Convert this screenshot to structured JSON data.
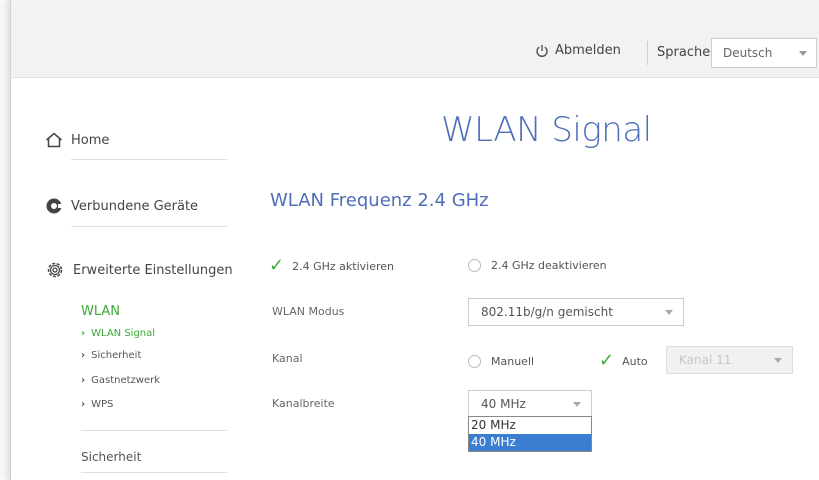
{
  "header": {
    "logout_label": "Abmelden",
    "language_label": "Sprache",
    "language_value": "Deutsch"
  },
  "sidebar": {
    "home": "Home",
    "devices": "Verbundene Geräte",
    "advanced": "Erweiterte Einstellungen",
    "wlan": "WLAN",
    "items": [
      {
        "label": "WLAN Signal",
        "active": true
      },
      {
        "label": "Sicherheit",
        "active": false
      },
      {
        "label": "Gastnetzwerk",
        "active": false
      },
      {
        "label": "WPS",
        "active": false
      }
    ],
    "security": "Sicherheit"
  },
  "main": {
    "title": "WLAN Signal",
    "section_title": "WLAN Frequenz 2.4 GHz",
    "enable_label": "2.4 GHz aktivieren",
    "disable_label": "2.4 GHz deaktivieren",
    "mode_label": "WLAN Modus",
    "mode_value": "802.11b/g/n gemischt",
    "channel_label": "Kanal",
    "manual_label": "Manuell",
    "auto_label": "Auto",
    "channel_value": "Kanal 11",
    "bandwidth_label": "Kanalbreite",
    "bandwidth_value": "40 MHz",
    "bandwidth_options": [
      "20 MHz",
      "40 MHz"
    ]
  },
  "colors": {
    "accent_green": "#3aaa35",
    "title_blue": "#4f6eb8",
    "selection_blue": "#3b7ed1"
  }
}
